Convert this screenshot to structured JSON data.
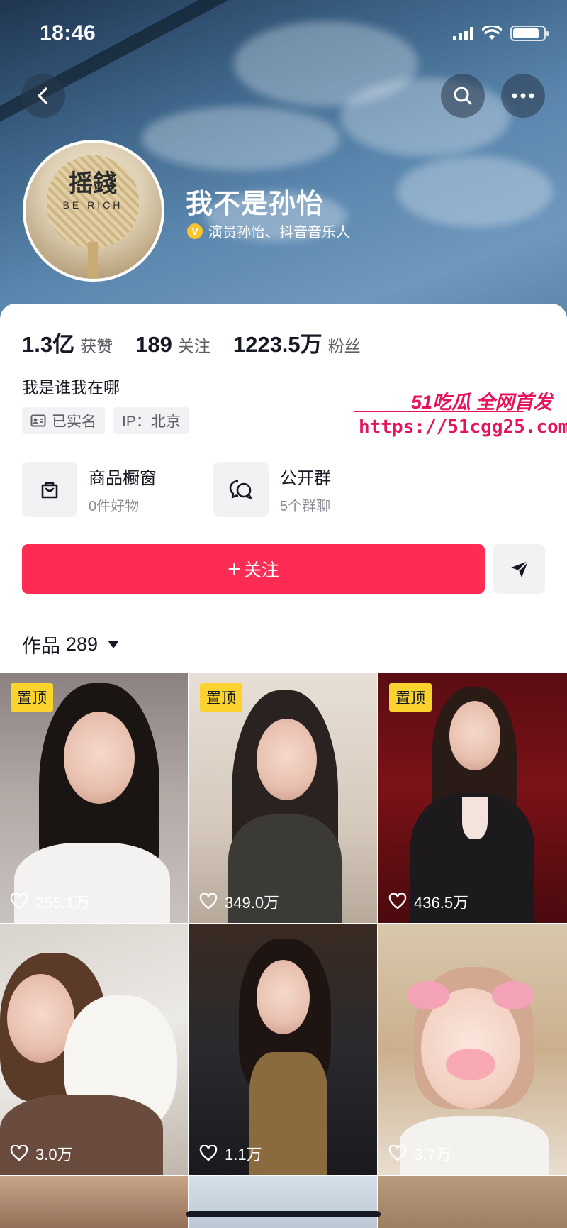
{
  "status_bar": {
    "time": "18:46",
    "battery_percent": 85
  },
  "profile": {
    "username": "我不是孙怡",
    "verification": "演员孙怡、抖音音乐人",
    "avatar_text": "摇錢",
    "avatar_subtext": "BE RICH",
    "bio": "我是谁我在哪"
  },
  "stats": [
    {
      "num": "1.3亿",
      "label": "获赞"
    },
    {
      "num": "189",
      "label": "关注"
    },
    {
      "num": "1223.5万",
      "label": "粉丝"
    }
  ],
  "tags": {
    "realname": "已实名",
    "ip": "IP：北京"
  },
  "watermark": {
    "top": "51吃瓜 全网首发",
    "url": "https://51cgg25.com"
  },
  "features": [
    {
      "title": "商品橱窗",
      "sub": "0件好物",
      "icon": "shopping-bag-icon"
    },
    {
      "title": "公开群",
      "sub": "5个群聊",
      "icon": "chat-bubbles-icon"
    }
  ],
  "actions": {
    "follow": "关注"
  },
  "works": {
    "tab_label": "作品",
    "count": "289",
    "pin_label": "置顶",
    "items": [
      {
        "likes": "255.1万",
        "pinned": true
      },
      {
        "likes": "349.0万",
        "pinned": true
      },
      {
        "likes": "436.5万",
        "pinned": true
      },
      {
        "likes": "3.0万",
        "pinned": false
      },
      {
        "likes": "1.1万",
        "pinned": false
      },
      {
        "likes": "3.7万",
        "pinned": false
      }
    ]
  },
  "colors": {
    "accent": "#fe2c55",
    "pin": "#fbd32e",
    "verify": "#f7c52b"
  }
}
